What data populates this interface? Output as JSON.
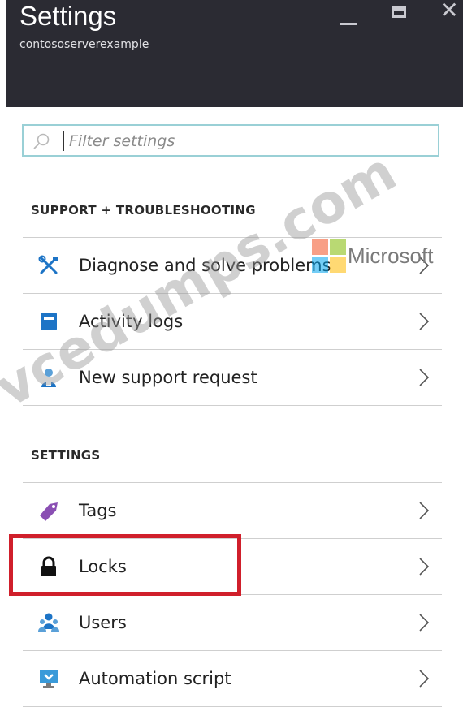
{
  "window": {
    "title": "Settings",
    "subtitle": "contososerverexample"
  },
  "filter": {
    "placeholder": "Filter settings",
    "value": ""
  },
  "sections": [
    {
      "title": "SUPPORT + TROUBLESHOOTING",
      "items": [
        {
          "label": "Diagnose and solve problems",
          "icon": "tools-icon"
        },
        {
          "label": "Activity logs",
          "icon": "activity-log-icon"
        },
        {
          "label": "New support request",
          "icon": "support-person-icon"
        }
      ]
    },
    {
      "title": "SETTINGS",
      "items": [
        {
          "label": "Tags",
          "icon": "tag-icon"
        },
        {
          "label": "Locks",
          "icon": "lock-icon"
        },
        {
          "label": "Users",
          "icon": "users-icon"
        },
        {
          "label": "Automation script",
          "icon": "automation-script-icon"
        }
      ]
    }
  ],
  "watermark": {
    "brand": "Microsoft",
    "site": "vcedumps.com"
  },
  "colors": {
    "header_bg": "#2b2b33",
    "filter_border": "#9ad0d6",
    "highlight": "#d01f2b",
    "tag": "#8a4fb3",
    "accent_blue": "#1d74c6"
  }
}
